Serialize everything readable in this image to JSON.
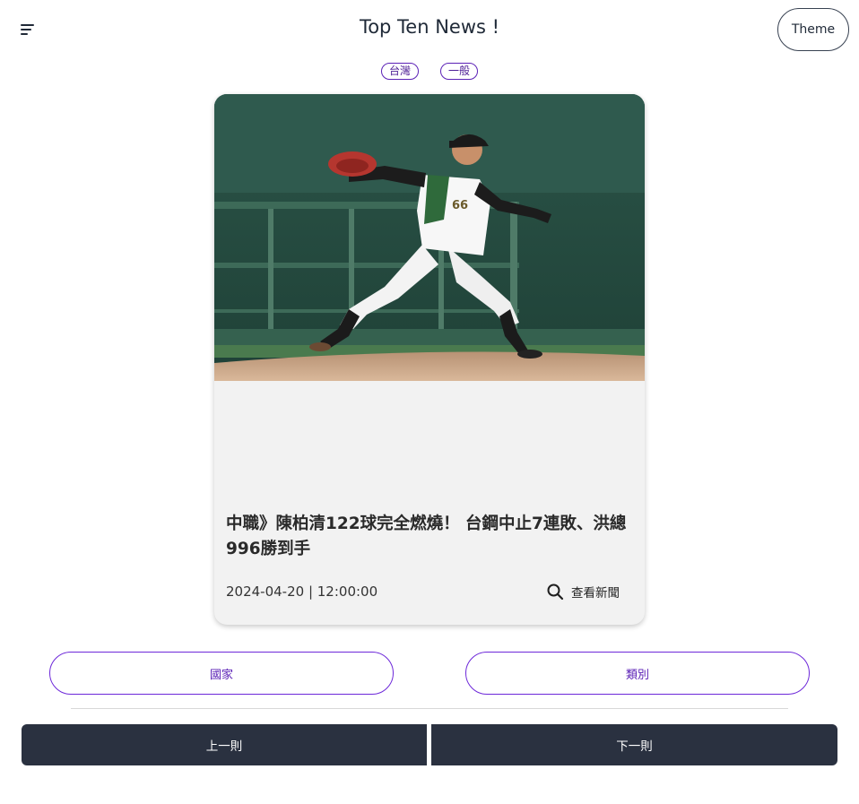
{
  "header": {
    "title": "Top Ten News !",
    "theme_label": "Theme",
    "menu_icon": "menu-icon"
  },
  "badges": [
    {
      "label": "台灣"
    },
    {
      "label": "一般"
    }
  ],
  "article": {
    "title": "中職》陳柏清122球完全燃燒！ 台鋼中止7連敗、洪總996勝到手",
    "date": "2024-04-20 | 12:00:00",
    "view_label": "查看新聞",
    "view_icon": "search-icon",
    "image_alt": "Baseball pitcher in green and white uniform throwing from the mound",
    "jersey_number": "66"
  },
  "filters": {
    "country_label": "國家",
    "category_label": "類別"
  },
  "navigation": {
    "prev_label": "上一則",
    "next_label": "下一則"
  },
  "colors": {
    "accent": "#6d28d9",
    "dark_button": "#2a3140",
    "card_bg": "#f2f2f2"
  }
}
